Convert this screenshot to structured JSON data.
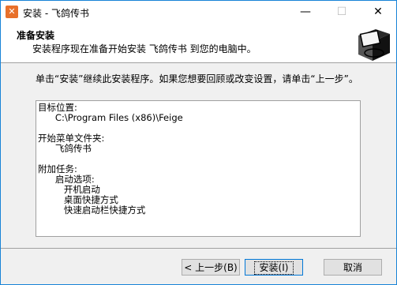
{
  "window": {
    "title": "安装 - 飞鸽传书",
    "minimize_glyph": "—",
    "maximize_glyph": "☐",
    "close_glyph": "✕"
  },
  "header": {
    "title": "准备安装",
    "subtitle": "安装程序现在准备开始安装 飞鸽传书 到您的电脑中。"
  },
  "instruction": "单击“安装”继续此安装程序。如果您想要回顾或改变设置，请单击“上一步”。",
  "memo": {
    "lines": [
      "目标位置:",
      "      C:\\Program Files (x86)\\Feige",
      "",
      "开始菜单文件夹:",
      "      飞鸽传书",
      "",
      "附加任务:",
      "      启动选项:",
      "         开机启动",
      "         桌面快捷方式",
      "         快速启动栏快捷方式"
    ]
  },
  "buttons": {
    "back": "< 上一步(B)",
    "install": "安装(I)",
    "cancel": "取消"
  },
  "colors": {
    "window_border": "#1883d7",
    "app_icon": "#e8702a",
    "dialog_bg": "#f0f0f0"
  },
  "icons": {
    "app": "app-logo-icon",
    "header": "installer-computer-icon"
  }
}
